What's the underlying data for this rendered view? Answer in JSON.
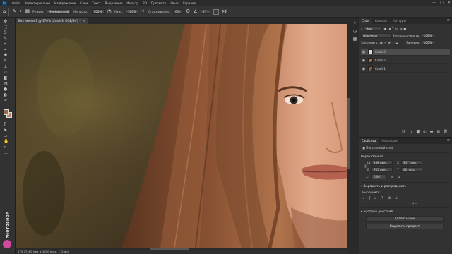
{
  "menubar": {
    "logo": "Ps",
    "items": [
      "Файл",
      "Редактирование",
      "Изображение",
      "Слои",
      "Текст",
      "Выделение",
      "Фильтр",
      "3D",
      "Просмотр",
      "Окно",
      "Справка"
    ],
    "window_controls": [
      "—",
      "□",
      "✕"
    ]
  },
  "options_bar": {
    "mode_label": "Режим:",
    "mode_value": "Нормальный",
    "opacity_label": "Непрозр.:",
    "opacity_value": "100%",
    "pressure_label": "Наж.:",
    "pressure_value": "100%",
    "smoothing_label": "Сглаживание:",
    "smoothing_value": "0%",
    "angle_value": "0°"
  },
  "document": {
    "tab_title": "Без имени-1 @ 176% (Слой 3, RGB/8#) *",
    "status_text": "175,77460 (мм, x 1200 пикс. 172 dpi)"
  },
  "tools": [
    {
      "icon": "move-icon",
      "glyph": "✥"
    },
    {
      "icon": "marquee-icon",
      "glyph": "⬚"
    },
    {
      "icon": "lasso-icon",
      "glyph": "ʘ"
    },
    {
      "icon": "quick-select-icon",
      "glyph": "✎"
    },
    {
      "icon": "crop-icon",
      "glyph": "⌗"
    },
    {
      "icon": "eyedropper-icon",
      "glyph": "✒"
    },
    {
      "icon": "healing-icon",
      "glyph": "✚"
    },
    {
      "icon": "brush-icon",
      "glyph": "✎"
    },
    {
      "icon": "stamp-icon",
      "glyph": "⊥"
    },
    {
      "icon": "history-brush-icon",
      "glyph": "↺"
    },
    {
      "icon": "eraser-icon",
      "glyph": "◧"
    },
    {
      "icon": "gradient-icon",
      "glyph": "▥"
    },
    {
      "icon": "blur-icon",
      "glyph": "●"
    },
    {
      "icon": "dodge-icon",
      "glyph": "◐"
    },
    {
      "icon": "pen-icon",
      "glyph": "✑"
    },
    {
      "icon": "type-icon",
      "glyph": "T"
    },
    {
      "icon": "path-select-icon",
      "glyph": "➤"
    },
    {
      "icon": "shape-icon",
      "glyph": "▭"
    },
    {
      "icon": "hand-icon",
      "glyph": "✋"
    },
    {
      "icon": "zoom-icon",
      "glyph": "⌕"
    },
    {
      "icon": "more-tools-icon",
      "glyph": "…"
    }
  ],
  "colors": {
    "foreground": "#9c6a4f",
    "background": "#b98364",
    "accent": "#31a8ff"
  },
  "watermark": "PHOTOSHOP",
  "layers_panel": {
    "tabs": [
      "Слои",
      "Каналы",
      "Контуры"
    ],
    "kind_label": "Вид",
    "blend_mode": "Обычные",
    "opacity_label": "Непрозрачность:",
    "opacity_value": "100%",
    "lock_label": "Закрепить:",
    "fill_label": "Заливка:",
    "fill_value": "100%",
    "layers": [
      {
        "name": "Слой 3",
        "visible": true,
        "selected": true
      },
      {
        "name": "Слой 2",
        "visible": true,
        "selected": false
      },
      {
        "name": "Слой 1",
        "visible": true,
        "selected": false
      }
    ],
    "footer_icons": [
      "link-icon",
      "fx-icon",
      "mask-icon",
      "adjustment-icon",
      "folder-icon",
      "new-layer-icon",
      "trash-icon"
    ]
  },
  "properties_panel": {
    "tabs": [
      "Свойства",
      "Операции"
    ],
    "layer_type": "Пиксельный слой",
    "transform_title": "Перекатанная",
    "w_label": "Ш",
    "w_value": "288 пикс.",
    "x_label": "X",
    "x_value": "347 пикс.",
    "h_label": "В",
    "h_value": "765 пикс.",
    "y_label": "Y",
    "y_value": "40 пикс.",
    "angle_value": "0,00°",
    "align_title": "Выровнять и распределить",
    "align_label": "Выровнить:",
    "more": "•••",
    "quick_title": "Быстрые действия",
    "btn_remove_bg": "Удалить фон",
    "btn_select_subject": "Выделить предмет"
  }
}
